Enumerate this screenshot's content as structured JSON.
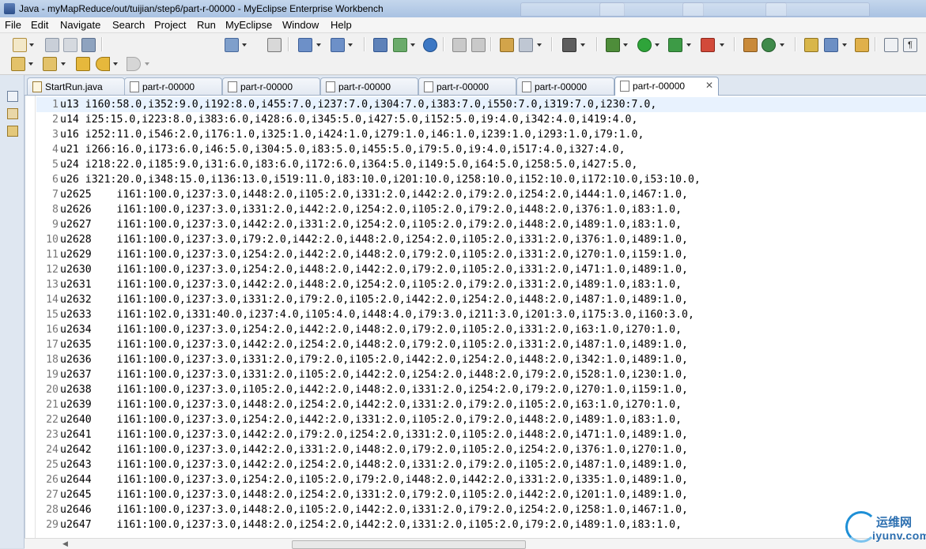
{
  "window": {
    "title": "Java - myMapReduce/out/tuijian/step6/part-r-00000 - MyEclipse Enterprise Workbench"
  },
  "menu": [
    "File",
    "Edit",
    "Navigate",
    "Search",
    "Project",
    "Run",
    "MyEclipse",
    "Window",
    "Help"
  ],
  "editor_tabs": [
    {
      "label": "StartRun.java",
      "type": "java",
      "active": false
    },
    {
      "label": "part-r-00000",
      "type": "text",
      "active": false
    },
    {
      "label": "part-r-00000",
      "type": "text",
      "active": false
    },
    {
      "label": "part-r-00000",
      "type": "text",
      "active": false
    },
    {
      "label": "part-r-00000",
      "type": "text",
      "active": false
    },
    {
      "label": "part-r-00000",
      "type": "text",
      "active": false
    },
    {
      "label": "part-r-00000",
      "type": "text",
      "active": true
    }
  ],
  "editor": {
    "lines": [
      "u13 i160:58.0,i352:9.0,i192:8.0,i455:7.0,i237:7.0,i304:7.0,i383:7.0,i550:7.0,i319:7.0,i230:7.0,",
      "u14 i25:15.0,i223:8.0,i383:6.0,i428:6.0,i345:5.0,i427:5.0,i152:5.0,i9:4.0,i342:4.0,i419:4.0,",
      "u16 i252:11.0,i546:2.0,i176:1.0,i325:1.0,i424:1.0,i279:1.0,i46:1.0,i239:1.0,i293:1.0,i79:1.0,",
      "u21 i266:16.0,i173:6.0,i46:5.0,i304:5.0,i83:5.0,i455:5.0,i79:5.0,i9:4.0,i517:4.0,i327:4.0,",
      "u24 i218:22.0,i185:9.0,i31:6.0,i83:6.0,i172:6.0,i364:5.0,i149:5.0,i64:5.0,i258:5.0,i427:5.0,",
      "u26 i321:20.0,i348:15.0,i136:13.0,i519:11.0,i83:10.0,i201:10.0,i258:10.0,i152:10.0,i172:10.0,i53:10.0,",
      "u2625    i161:100.0,i237:3.0,i448:2.0,i105:2.0,i331:2.0,i442:2.0,i79:2.0,i254:2.0,i444:1.0,i467:1.0,",
      "u2626    i161:100.0,i237:3.0,i331:2.0,i442:2.0,i254:2.0,i105:2.0,i79:2.0,i448:2.0,i376:1.0,i83:1.0,",
      "u2627    i161:100.0,i237:3.0,i442:2.0,i331:2.0,i254:2.0,i105:2.0,i79:2.0,i448:2.0,i489:1.0,i83:1.0,",
      "u2628    i161:100.0,i237:3.0,i79:2.0,i442:2.0,i448:2.0,i254:2.0,i105:2.0,i331:2.0,i376:1.0,i489:1.0,",
      "u2629    i161:100.0,i237:3.0,i254:2.0,i442:2.0,i448:2.0,i79:2.0,i105:2.0,i331:2.0,i270:1.0,i159:1.0,",
      "u2630    i161:100.0,i237:3.0,i254:2.0,i448:2.0,i442:2.0,i79:2.0,i105:2.0,i331:2.0,i471:1.0,i489:1.0,",
      "u2631    i161:100.0,i237:3.0,i442:2.0,i448:2.0,i254:2.0,i105:2.0,i79:2.0,i331:2.0,i489:1.0,i83:1.0,",
      "u2632    i161:100.0,i237:3.0,i331:2.0,i79:2.0,i105:2.0,i442:2.0,i254:2.0,i448:2.0,i487:1.0,i489:1.0,",
      "u2633    i161:102.0,i331:40.0,i237:4.0,i105:4.0,i448:4.0,i79:3.0,i211:3.0,i201:3.0,i175:3.0,i160:3.0,",
      "u2634    i161:100.0,i237:3.0,i254:2.0,i442:2.0,i448:2.0,i79:2.0,i105:2.0,i331:2.0,i63:1.0,i270:1.0,",
      "u2635    i161:100.0,i237:3.0,i442:2.0,i254:2.0,i448:2.0,i79:2.0,i105:2.0,i331:2.0,i487:1.0,i489:1.0,",
      "u2636    i161:100.0,i237:3.0,i331:2.0,i79:2.0,i105:2.0,i442:2.0,i254:2.0,i448:2.0,i342:1.0,i489:1.0,",
      "u2637    i161:100.0,i237:3.0,i331:2.0,i105:2.0,i442:2.0,i254:2.0,i448:2.0,i79:2.0,i528:1.0,i230:1.0,",
      "u2638    i161:100.0,i237:3.0,i105:2.0,i442:2.0,i448:2.0,i331:2.0,i254:2.0,i79:2.0,i270:1.0,i159:1.0,",
      "u2639    i161:100.0,i237:3.0,i448:2.0,i254:2.0,i442:2.0,i331:2.0,i79:2.0,i105:2.0,i63:1.0,i270:1.0,",
      "u2640    i161:100.0,i237:3.0,i254:2.0,i442:2.0,i331:2.0,i105:2.0,i79:2.0,i448:2.0,i489:1.0,i83:1.0,",
      "u2641    i161:100.0,i237:3.0,i442:2.0,i79:2.0,i254:2.0,i331:2.0,i105:2.0,i448:2.0,i471:1.0,i489:1.0,",
      "u2642    i161:100.0,i237:3.0,i442:2.0,i331:2.0,i448:2.0,i79:2.0,i105:2.0,i254:2.0,i376:1.0,i270:1.0,",
      "u2643    i161:100.0,i237:3.0,i442:2.0,i254:2.0,i448:2.0,i331:2.0,i79:2.0,i105:2.0,i487:1.0,i489:1.0,",
      "u2644    i161:100.0,i237:3.0,i254:2.0,i105:2.0,i79:2.0,i448:2.0,i442:2.0,i331:2.0,i335:1.0,i489:1.0,",
      "u2645    i161:100.0,i237:3.0,i448:2.0,i254:2.0,i331:2.0,i79:2.0,i105:2.0,i442:2.0,i201:1.0,i489:1.0,",
      "u2646    i161:100.0,i237:3.0,i448:2.0,i105:2.0,i442:2.0,i331:2.0,i79:2.0,i254:2.0,i258:1.0,i467:1.0,",
      "u2647    i161:100.0,i237:3.0,i448:2.0,i254:2.0,i442:2.0,i331:2.0,i105:2.0,i79:2.0,i489:1.0,i83:1.0,"
    ]
  },
  "watermark": {
    "cn": "运维网",
    "en": "iyunv.com"
  }
}
